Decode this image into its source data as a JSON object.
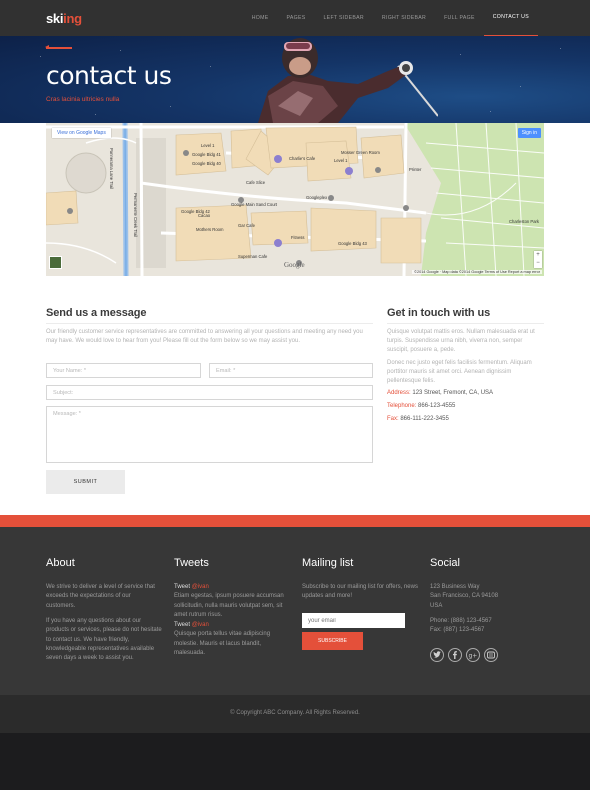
{
  "header": {
    "logo_part1": "ski",
    "logo_part2": "ing",
    "nav": [
      "HOME",
      "PAGES",
      "LEFT SIDEBAR",
      "RIGHT SIDEBAR",
      "FULL PAGE",
      "CONTACT US"
    ],
    "active_nav": "CONTACT US"
  },
  "hero": {
    "title": "contact us",
    "subtitle": "Cras lacinia ultricies nulla"
  },
  "map": {
    "view_link": "View on Google Maps",
    "sign_in": "Sign in",
    "zoom_in": "+",
    "zoom_out": "−",
    "logo": "Google",
    "attribution": "©2014 Google · Map data ©2014 Google    Terms of Use    Report a map error",
    "labels": [
      "Level 1",
      "Charlie's Cafe",
      "Level 1",
      "Google Bldg 41",
      "Google Bldg 40",
      "Mosser Green Room",
      "Cafe Slice",
      "Googleplex",
      "Printer",
      "Google Main Sand Court",
      "Google Bldg 42",
      "Gar Cafe",
      "Google Bldg 43",
      "Charleston Park",
      "Superman Cafe",
      "Pannerama Lane Trail",
      "Permanente Creek Trail",
      "Cacao",
      "Mothers Room",
      "Fitness"
    ]
  },
  "contact": {
    "form_title": "Send us a message",
    "intro": "Our friendly customer service representatives are committed to answering all your questions and meeting any need you may have. We would love to hear from you! Please fill out the form below so we may assist you.",
    "name_placeholder": "Your Name: *",
    "email_placeholder": "Email: *",
    "subject_placeholder": "Subject:",
    "message_placeholder": "Message: *",
    "submit": "SUBMIT"
  },
  "touch": {
    "title": "Get in touch with us",
    "para1": "Quisque volutpat mattis eros. Nullam malesuada erat ut turpis. Suspendisse urna nibh, viverra non, semper suscipit, posuere a, pede.",
    "para2": "Donec nec justo eget felis facilisis fermentum. Aliquam porttitor mauris sit amet orci. Aenean dignissim pellentesque felis.",
    "address_label": "Address:",
    "address": "123 Street, Fremont, CA, USA",
    "phone_label": "Telephone:",
    "phone": "866-123-4555",
    "fax_label": "Fax:",
    "fax": "866-111-222-3455"
  },
  "footer": {
    "about_title": "About",
    "about_p1": "We strive to deliver a level of service that exceeds the expectations of our customers.",
    "about_p2": "If you have any questions about our products or services, please do not hesitate to contact us. We have friendly, knowledgeable representatives available seven days a week to assist you.",
    "tweets_title": "Tweets",
    "tweet_word": "Tweet",
    "tweet_handle": "@ivan",
    "tweet1": "Etiam egestas, ipsum posuere accumsan sollicitudin, nulla mauris volutpat sem, sit amet rutrum risus.",
    "tweet2": "Quisque porta tellus vitae adipiscing molestie. Mauris et lacus blandit, malesuada.",
    "mailing_title": "Mailing list",
    "mailing_text": "Subscribe to our mailing list for offers, news updates and more!",
    "mail_placeholder": "your email",
    "subscribe": "SUBSCRIBE",
    "social_title": "Social",
    "social_addr1": "123 Business Way",
    "social_addr2": "San Francisco, CA 94108",
    "social_addr3": "USA",
    "social_phone": "Phone: (888) 123-4567",
    "social_fax": "Fax: (887) 123-4567",
    "copyright": "© Copyright ABC Company. All Rights Reserved."
  },
  "colors": {
    "accent": "#e4503a",
    "footer": "#373737",
    "topbar": "#313131"
  },
  "icons": [
    "twitter-icon",
    "facebook-icon",
    "google-plus-icon",
    "skype-icon"
  ]
}
